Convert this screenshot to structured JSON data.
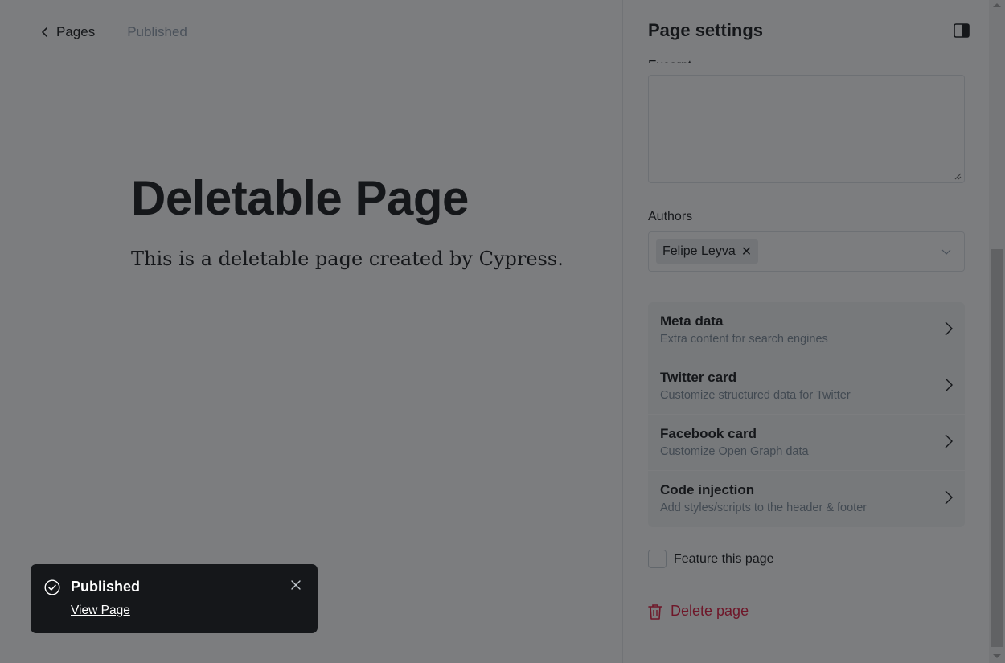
{
  "editor": {
    "back_label": "Pages",
    "status": "Published",
    "title": "Deletable Page",
    "body": "This is a deletable page created by Cypress."
  },
  "settings": {
    "title": "Page settings",
    "clipped_label": "Excerpt",
    "excerpt_value": "",
    "authors_label": "Authors",
    "authors": [
      "Felipe Leyva"
    ],
    "nav_items": [
      {
        "title": "Meta data",
        "description": "Extra content for search engines"
      },
      {
        "title": "Twitter card",
        "description": "Customize structured data for Twitter"
      },
      {
        "title": "Facebook card",
        "description": "Customize Open Graph data"
      },
      {
        "title": "Code injection",
        "description": "Add styles/scripts to the header & footer"
      }
    ],
    "feature_label": "Feature this page",
    "feature_checked": false,
    "delete_label": "Delete page"
  },
  "toast": {
    "title": "Published",
    "link": "View Page"
  },
  "icons": {
    "back": "chevron-left-icon",
    "panel_toggle": "sidebar-toggle-icon",
    "remove_author": "close-icon",
    "dropdown": "chevron-down-icon",
    "nav_arrow": "chevron-right-icon",
    "delete": "trash-icon",
    "toast_status": "check-circle-icon",
    "toast_close": "close-icon"
  },
  "colors": {
    "text": "#15171a",
    "muted": "#8e9cac",
    "danger": "#e0173d",
    "toast_bg": "#15171a",
    "overlay": "rgba(21,23,26,0.56)"
  }
}
